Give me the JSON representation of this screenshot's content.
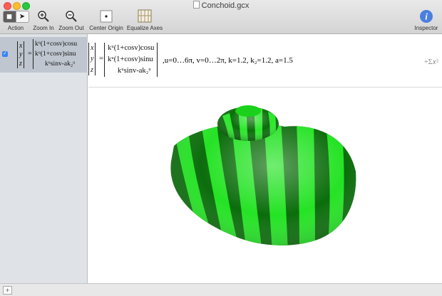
{
  "window": {
    "title": "Conchoid.gcx"
  },
  "toolbar": {
    "action": "Action",
    "zoom_in": "Zoom In",
    "zoom_out": "Zoom Out",
    "center_origin": "Center Origin",
    "equalize_axes": "Equalize Axes",
    "inspector": "Inspector"
  },
  "sidebar": {
    "items": [
      {
        "checked": true,
        "vars": [
          "x",
          "y",
          "z"
        ],
        "exprs": [
          "kᵘ(1+cosv)cosu",
          "kᵘ(1+cosv)sinu",
          "kᵘsinv-ak₂ᵘ"
        ]
      }
    ]
  },
  "formula": {
    "vars": [
      "x",
      "y",
      "z"
    ],
    "exprs": [
      "kᵘ(1+cosv)cosu",
      "kᵘ(1+cosv)sinu",
      "kᵘsinv-ak₂ᵘ"
    ],
    "params": ",u=0…6π, v=0…2π, k=1.2, k₂=1.2, a=1.5",
    "sigma": "+Σ𝑥²"
  },
  "colors": {
    "surface_light": "#22dd22",
    "surface_dark": "#0a6a0a",
    "accent": "#3d7fe0"
  },
  "statusbar": {
    "add_label": "+"
  }
}
